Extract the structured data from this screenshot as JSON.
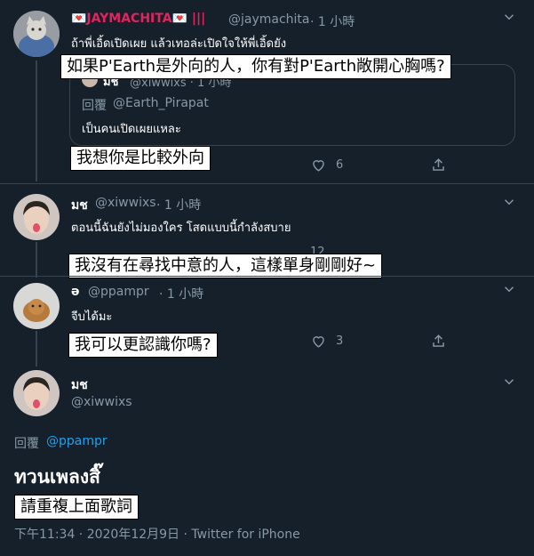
{
  "tweets": [
    {
      "name": "💌JAYMACHITA💌 |||",
      "handle": "@jaymachita",
      "time": "· 1 小時",
      "text": "ถ้าพี่เอิ้ดเปิดเผย แล้วเทอล่ะเปิดใจให้พี่เอิ้ดยัง",
      "quote": {
        "name": "มช",
        "handle": "@xiwwixs · 1 小時",
        "reply_to_label": "回覆",
        "reply_to_handle": "@Earth_Pirapat",
        "text": "เป็นคนเปิดเผยแหละ"
      },
      "like_count": "6",
      "overlay_top": "如果P'Earth是外向的人，你有對P'Earth敞開心胸嗎?",
      "overlay_bottom": "我想你是比較外向"
    },
    {
      "name": "มช",
      "handle": "@xiwwixs",
      "time": "· 1 小時",
      "text": "ตอนนี้ฉันยังไม่มองใคร โสดแบบนี้กำลังสบาย",
      "like_count": "12",
      "overlay": "我沒有在尋找中意的人，這樣單身剛剛好~"
    },
    {
      "name": "ə",
      "handle": "@ppampr",
      "time": "· 1 小時",
      "text": "จีบได้มะ",
      "like_count": "3",
      "overlay": "我可以更認識你嗎?"
    }
  ],
  "main": {
    "name": "มช",
    "handle": "@xiwwixs",
    "reply_to_label": "回覆",
    "reply_to_handle": "@ppampr",
    "text": "ทวนเพลงสิ๊",
    "overlay": "請重複上面歌詞",
    "meta": "下午11:34 · 2020年12月9日 · Twitter for iPhone"
  }
}
